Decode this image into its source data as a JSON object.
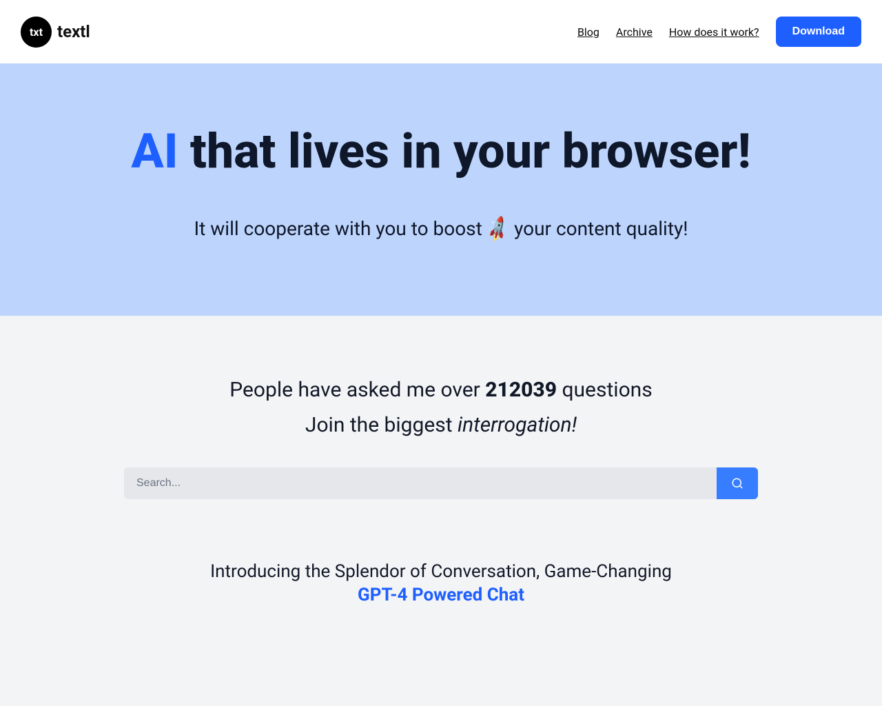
{
  "header": {
    "logo_icon_text": "txt",
    "logo_text": "textl",
    "nav": {
      "blog": "Blog",
      "archive": "Archive",
      "how": "How does it work?",
      "download": "Download"
    }
  },
  "hero": {
    "title_ai": "AI",
    "title_rest": " that lives in your browser!",
    "subtitle_before": "It will cooperate with you to boost ",
    "subtitle_after": " your content quality!"
  },
  "content": {
    "stats_before": "People have asked me over ",
    "stats_number": "212039",
    "stats_after": " questions",
    "join_before": "Join the biggest ",
    "join_italic": "interrogation!",
    "search_placeholder": "Search...",
    "intro": "Introducing the Splendor of Conversation, Game-Changing",
    "gpt": "GPT-4 Powered Chat"
  }
}
